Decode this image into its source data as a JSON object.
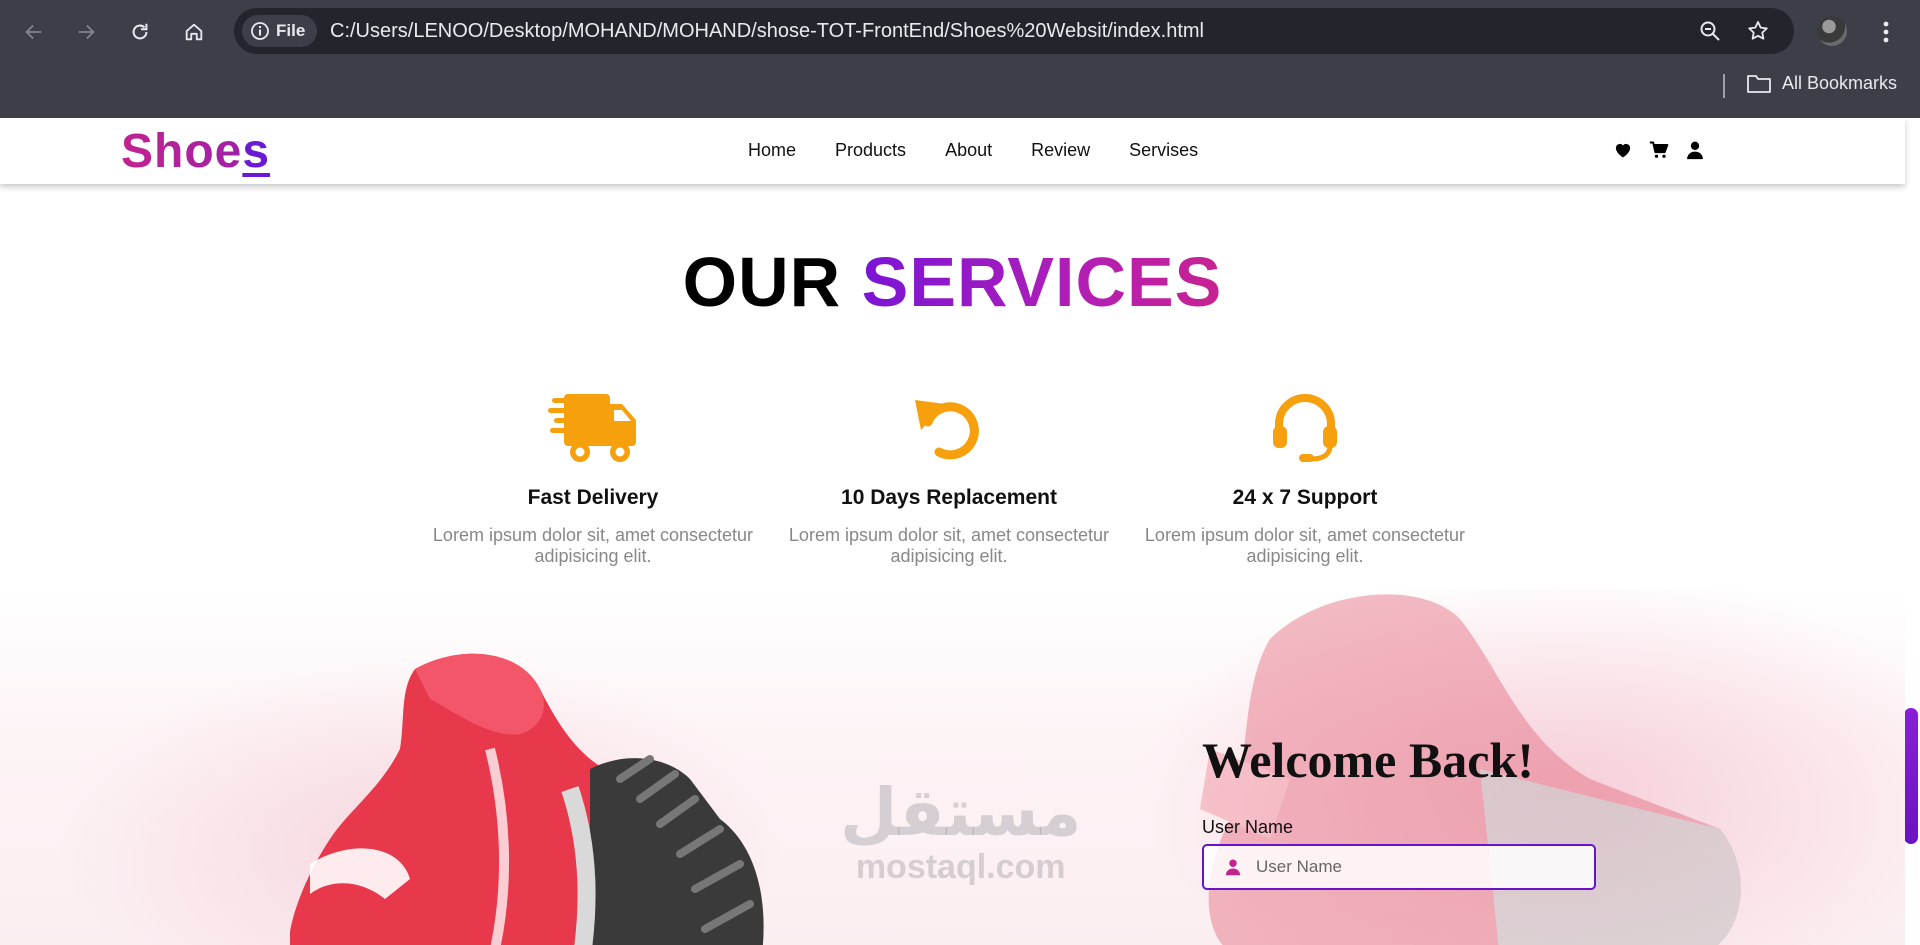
{
  "browser": {
    "site_chip": "File",
    "url": "C:/Users/LENOO/Desktop/MOHAND/MOHAND/shose-TOT-FrontEnd/Shoes%20Websit/index.html",
    "bookmarks_label": "All Bookmarks"
  },
  "header": {
    "logo_main": "Shoe",
    "logo_last": "s",
    "nav": [
      "Home",
      "Products",
      "About",
      "Review",
      "Servises"
    ]
  },
  "services": {
    "title_word1": "OUR",
    "title_word2": "SERVICES",
    "items": [
      {
        "icon": "truck-icon",
        "title": "Fast Delivery",
        "text": "Lorem ipsum dolor sit, amet consectetur adipisicing elit."
      },
      {
        "icon": "rotate-left-icon",
        "title": "10 Days Replacement",
        "text": "Lorem ipsum dolor sit, amet consectetur adipisicing elit."
      },
      {
        "icon": "headset-icon",
        "title": "24 x 7 Support",
        "text": "Lorem ipsum dolor sit, amet consectetur adipisicing elit."
      }
    ]
  },
  "watermark": {
    "arabic": "مستقل",
    "latin": "mostaql.com"
  },
  "login": {
    "heading": "Welcome Back!",
    "username_label": "User Name",
    "username_placeholder": "User Name"
  },
  "colors": {
    "accent_orange": "#f5a00c",
    "brand_purple": "#6a14c8",
    "brand_pink": "#c2238f",
    "chrome_bg": "#3c3e48"
  }
}
